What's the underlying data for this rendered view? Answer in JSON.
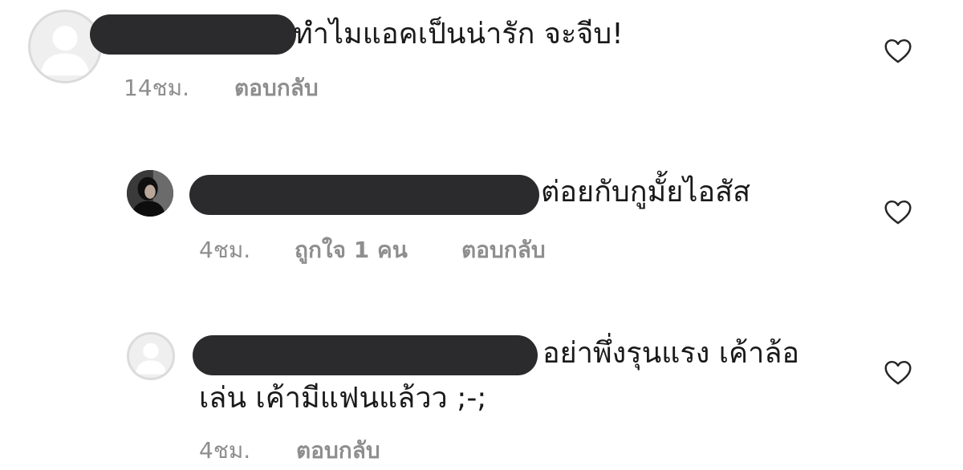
{
  "comments": [
    {
      "avatar": "default-avatar-icon",
      "text": "ทำไมแอคเป็นน่ารัก จะจีบ!",
      "time": "14ชม.",
      "reply": "ตอบกลับ"
    },
    {
      "avatar": "user-photo-avatar",
      "text": "ต่อยกับกูมั้ยไอสัส",
      "time": "4ชม.",
      "likes": "ถูกใจ 1 คน",
      "reply": "ตอบกลับ"
    },
    {
      "avatar": "default-avatar-icon",
      "text_line1": "อย่าพึ่งรุนแรง เค้าล้อ",
      "text_line2": "เล่น เค้ามีแฟนแล้วว ;-;",
      "time": "4ชม.",
      "reply": "ตอบกลับ"
    }
  ],
  "icons": {
    "like": "heart-outline-icon"
  },
  "colors": {
    "text": "#262626",
    "meta": "#8e8e8e",
    "redaction": "#2b2b2d",
    "icon": "#262626"
  }
}
